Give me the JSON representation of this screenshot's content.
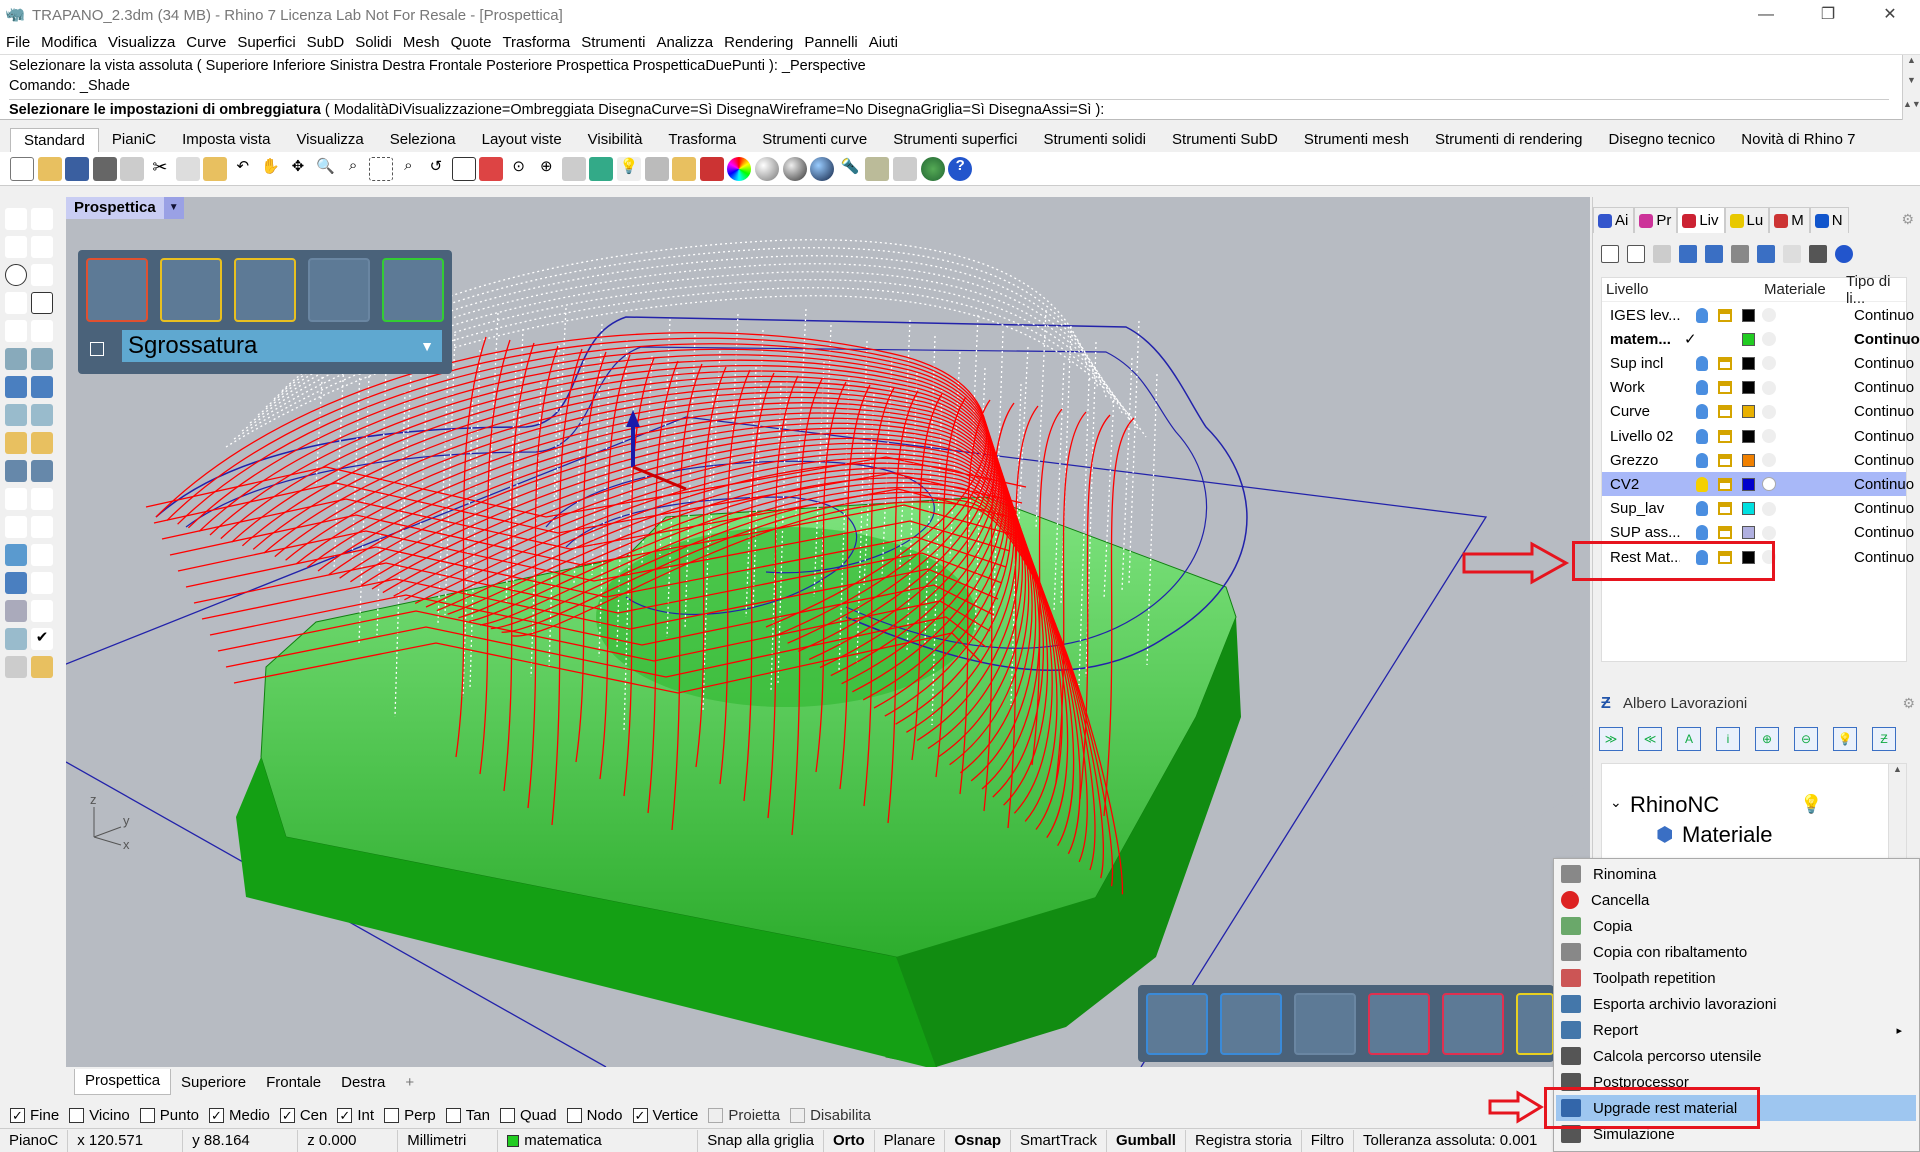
{
  "titlebar": {
    "title": "TRAPANO_2.3dm (34 MB) - Rhino 7 Licenza Lab Not For Resale - [Prospettica]",
    "minimize": "—",
    "restore": "❐",
    "close": "✕"
  },
  "menubar": [
    "File",
    "Modifica",
    "Visualizza",
    "Curve",
    "Superfici",
    "SubD",
    "Solidi",
    "Mesh",
    "Quote",
    "Trasforma",
    "Strumenti",
    "Analizza",
    "Rendering",
    "Pannelli",
    "Aiuti"
  ],
  "command": {
    "history_1": "Selezionare la vista assoluta ( Superiore  Inferiore  Sinistra  Destra  Frontale  Posteriore  Prospettica  ProspetticaDuePunti ): _Perspective",
    "history_2": "Comando: _Shade",
    "prompt_bold": "Selezionare le impostazioni di ombreggiatura",
    "prompt_rest": " ( ModalitàDiVisualizzazione=Ombreggiata  DisegnaCurve=Sì  DisegnaWireframe=No  DisegnaGriglia=Sì  DisegnaAssi=Sì ):"
  },
  "toolbar_tabs": [
    "Standard",
    "PianiC",
    "Imposta vista",
    "Visualizza",
    "Seleziona",
    "Layout viste",
    "Visibilità",
    "Trasforma",
    "Strumenti curve",
    "Strumenti superfici",
    "Strumenti solidi",
    "Strumenti SubD",
    "Strumenti mesh",
    "Strumenti di rendering",
    "Disegno tecnico",
    "Novità di Rhino 7"
  ],
  "viewport": {
    "title": "Prospettica",
    "dropdown": "▼",
    "cam_dropdown_value": "Sgrossatura",
    "axis_z": "z",
    "axis_y": "y",
    "axis_x": "x",
    "bottom_tabs": [
      "Prospettica",
      "Superiore",
      "Frontale",
      "Destra"
    ],
    "add_tab": "+"
  },
  "osnaps": [
    {
      "label": "Fine",
      "checked": true
    },
    {
      "label": "Vicino",
      "checked": false
    },
    {
      "label": "Punto",
      "checked": false
    },
    {
      "label": "Medio",
      "checked": true
    },
    {
      "label": "Cen",
      "checked": true
    },
    {
      "label": "Int",
      "checked": true
    },
    {
      "label": "Perp",
      "checked": false
    },
    {
      "label": "Tan",
      "checked": false
    },
    {
      "label": "Quad",
      "checked": false
    },
    {
      "label": "Nodo",
      "checked": false
    },
    {
      "label": "Vertice",
      "checked": true
    },
    {
      "label": "Proietta",
      "checked": false,
      "disabled": true
    },
    {
      "label": "Disabilita",
      "checked": false,
      "disabled": true
    }
  ],
  "status": {
    "cplane": "PianoC",
    "x": "x 120.571",
    "y": "y 88.164",
    "z": "z 0.000",
    "units": "Millimetri",
    "layer": "matematica",
    "layer_color": "#22cc22",
    "snap": "Snap alla griglia",
    "orto": "Orto",
    "planare": "Planare",
    "osnap": "Osnap",
    "smarttrack": "SmartTrack",
    "gumball": "Gumball",
    "history": "Registra storia",
    "filtro": "Filtro",
    "tolerance": "Tolleranza assoluta: 0.001"
  },
  "panel_tabs": [
    {
      "label": "Ai",
      "color": "#3355cc"
    },
    {
      "label": "Pr",
      "color": "#cc3399"
    },
    {
      "label": "Liv",
      "color": "#cc2233"
    },
    {
      "label": "Lu",
      "color": "#e8c800"
    },
    {
      "label": "M",
      "color": "#cc3333"
    },
    {
      "label": "N",
      "color": "#1155cc"
    }
  ],
  "layers": {
    "col_name": "Livello",
    "col_material": "Materiale",
    "col_type": "Tipo di li...",
    "rows": [
      {
        "name": "IGES lev...",
        "color": "#000000",
        "type": "Continuo",
        "current": false,
        "bold": false
      },
      {
        "name": "matem...",
        "color": "#22cc22",
        "type": "Continuo",
        "current": true,
        "bold": true
      },
      {
        "name": "Sup incl",
        "color": "#000000",
        "type": "Continuo",
        "current": false,
        "bold": false
      },
      {
        "name": "Work",
        "color": "#000000",
        "type": "Continuo",
        "current": false,
        "bold": false
      },
      {
        "name": "Curve",
        "color": "#e8b000",
        "type": "Continuo",
        "current": false,
        "bold": false
      },
      {
        "name": "Livello 02",
        "color": "#000000",
        "type": "Continuo",
        "current": false,
        "bold": false
      },
      {
        "name": "Grezzo",
        "color": "#f08000",
        "type": "Continuo",
        "current": false,
        "bold": false
      },
      {
        "name": "CV2",
        "color": "#0000cc",
        "type": "Continuo",
        "current": false,
        "bold": false,
        "selected": true
      },
      {
        "name": "Sup_lav",
        "color": "#00e0e0",
        "type": "Continuo",
        "current": false,
        "bold": false
      },
      {
        "name": "SUP ass...",
        "color": "#b0b0e0",
        "type": "Continuo",
        "current": false,
        "bold": false
      },
      {
        "name": "Rest Mat...",
        "color": "#000000",
        "type": "Continuo",
        "current": false,
        "bold": false
      }
    ],
    "current_mark": "✓"
  },
  "albero": {
    "title": "Albero Lavorazioni",
    "tree_root": "RhinoNC",
    "tree_child": "Materiale",
    "expander": "⌄"
  },
  "context_menu": [
    {
      "label": "Rinomina",
      "icon": "rename-icon",
      "color": "#888888"
    },
    {
      "label": "Cancella",
      "icon": "delete-icon",
      "color": "#dd2222"
    },
    {
      "label": "Copia",
      "icon": "copy-icon",
      "color": "#6aa86a"
    },
    {
      "label": "Copia con ribaltamento",
      "icon": "mirror-copy-icon",
      "color": "#888888"
    },
    {
      "label": "Toolpath repetition",
      "icon": "repeat-icon",
      "color": "#cc5555"
    },
    {
      "label": "Esporta archivio lavorazioni",
      "icon": "export-icon",
      "color": "#4477aa"
    },
    {
      "label": "Report",
      "icon": "report-icon",
      "color": "#4477aa",
      "submenu": true
    },
    {
      "label": "Calcola percorso utensile",
      "icon": "toolpath-icon",
      "color": "#555555"
    },
    {
      "label": "Postprocessor",
      "icon": "post-icon",
      "color": "#555555"
    },
    {
      "label": "Upgrade rest material",
      "icon": "rest-material-icon",
      "color": "#3366aa",
      "highlighted": true
    },
    {
      "label": "Simulazione",
      "icon": "simulation-icon",
      "color": "#555555"
    }
  ],
  "submenu_arrow": "▸",
  "colors": {
    "accent_red": "#e6141e",
    "toolpath_red": "#ff0000",
    "part_green": "#22cc22",
    "viewport_bg": "#b7bbc2",
    "highlight": "#9ec6f0"
  }
}
